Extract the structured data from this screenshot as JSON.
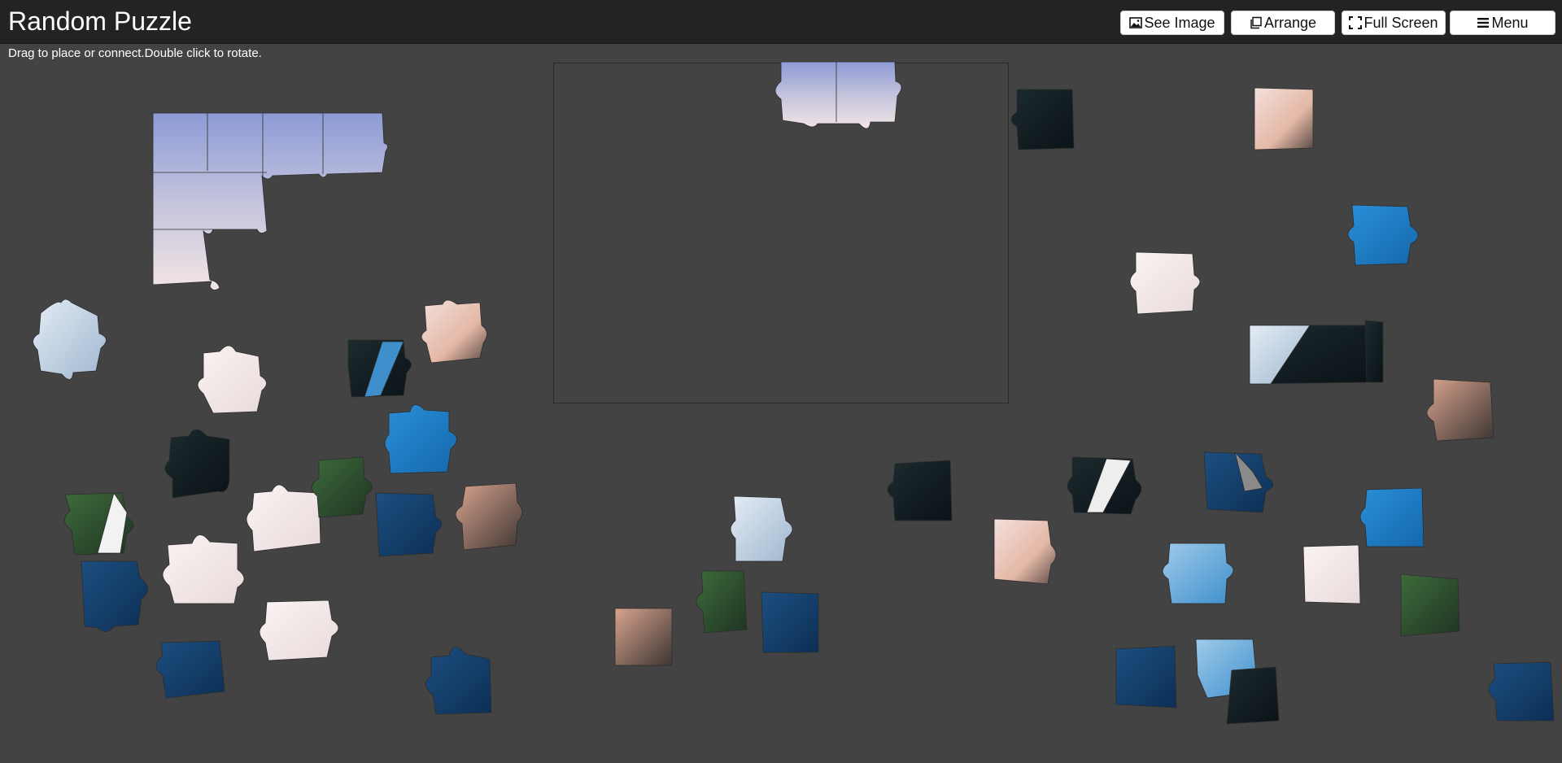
{
  "header": {
    "title": "Random Puzzle",
    "see_image_label": "See Image",
    "arrange_label": "Arrange",
    "fullscreen_label": "Full Screen",
    "menu_label": "Menu"
  },
  "hint": "Drag to place or connect.Double click to rotate.",
  "icons": {
    "see_image": "image-icon",
    "arrange": "copy-icon",
    "fullscreen": "expand-icon",
    "menu": "hamburger-menu-icon"
  },
  "colors": {
    "background": "#434343",
    "topbar": "#232323",
    "button_bg": "#ffffff"
  }
}
